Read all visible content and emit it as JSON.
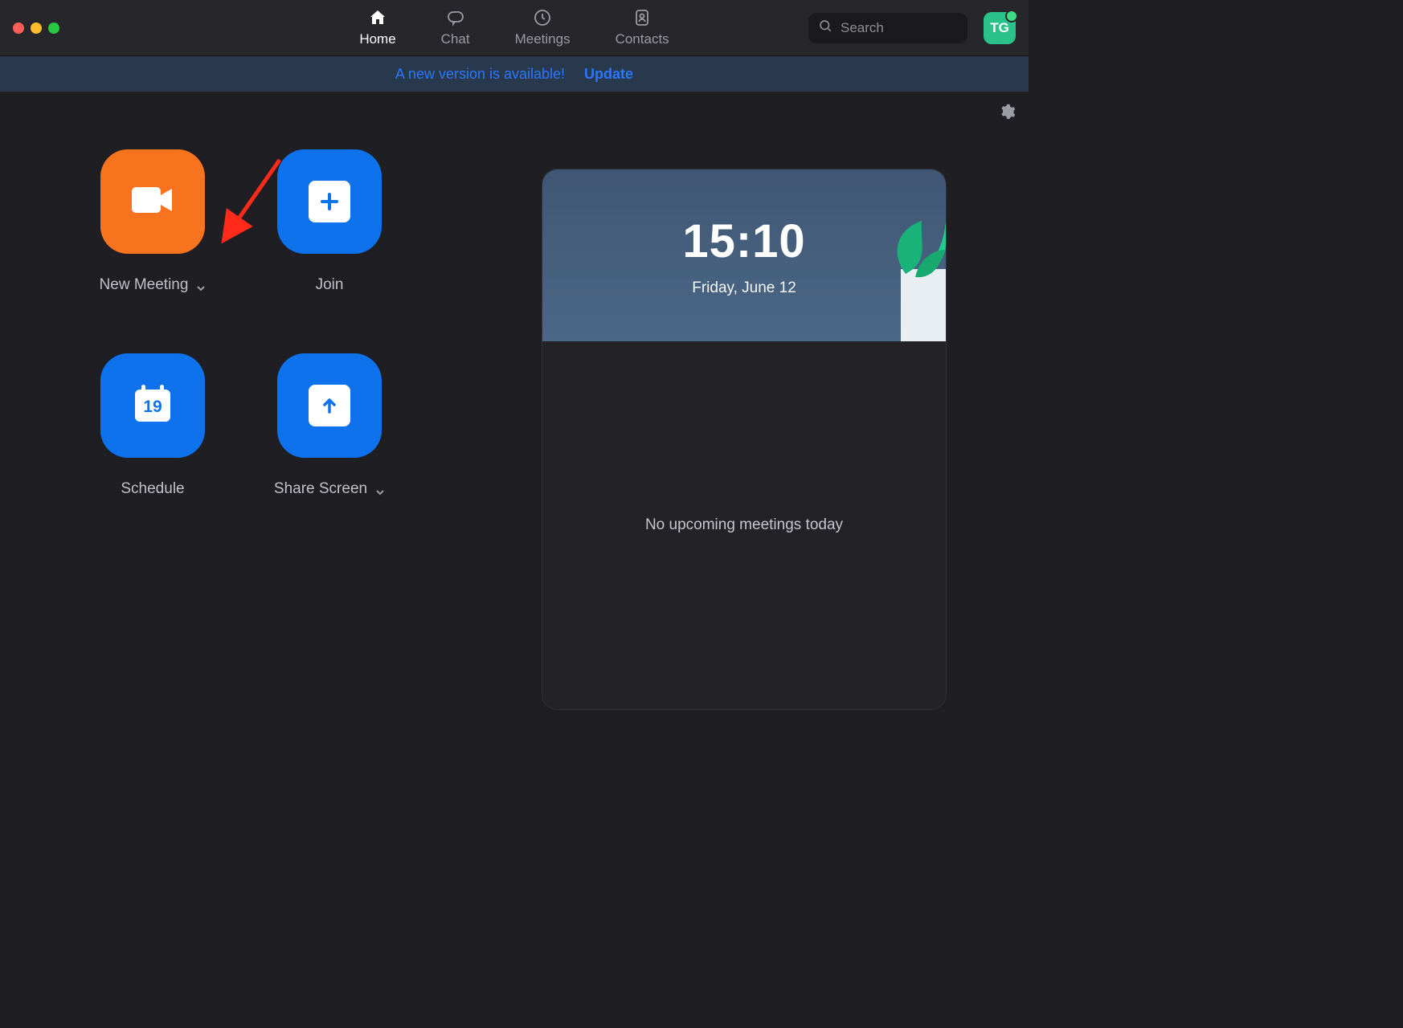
{
  "nav": {
    "tabs": [
      {
        "label": "Home",
        "icon": "home-icon",
        "active": true
      },
      {
        "label": "Chat",
        "icon": "chat-icon",
        "active": false
      },
      {
        "label": "Meetings",
        "icon": "clock-icon",
        "active": false
      },
      {
        "label": "Contacts",
        "icon": "contacts-icon",
        "active": false
      }
    ],
    "search_placeholder": "Search",
    "avatar_initials": "TG"
  },
  "banner": {
    "message": "A new version is available!",
    "action_label": "Update"
  },
  "tiles": {
    "new_meeting": {
      "label": "New Meeting",
      "dropdown": true
    },
    "join": {
      "label": "Join",
      "dropdown": false
    },
    "schedule": {
      "label": "Schedule",
      "dropdown": false,
      "day": "19"
    },
    "share": {
      "label": "Share Screen",
      "dropdown": true
    }
  },
  "clock": {
    "time": "15:10",
    "date": "Friday, June 12"
  },
  "upcoming_empty": "No upcoming meetings today",
  "colors": {
    "orange": "#f8731d",
    "blue": "#0d72eb",
    "accent": "#2b77ff"
  }
}
